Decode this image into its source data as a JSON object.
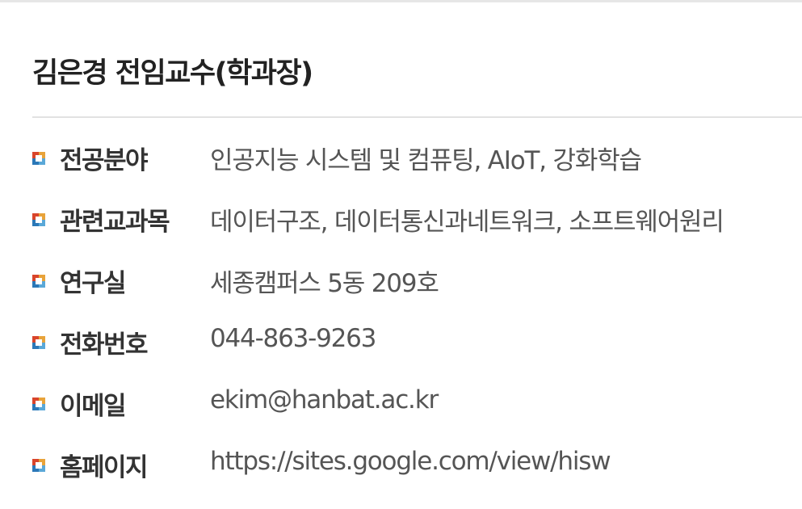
{
  "profile": {
    "name": "김은경 전임교수(학과장)"
  },
  "info_rows": [
    {
      "label": "전공분야",
      "value": "인공지능 시스템 및 컴퓨팅, AIoT, 강화학습"
    },
    {
      "label": "관련교과목",
      "value": "데이터구조, 데이터통신과네트워크, 소프트웨어원리"
    },
    {
      "label": "연구실",
      "value": "세종캠퍼스 5동 209호"
    },
    {
      "label": "전화번호",
      "value": "044-863-9263"
    },
    {
      "label": "이메일",
      "value": "ekim@hanbat.ac.kr"
    },
    {
      "label": "홈페이지",
      "value": "https://sites.google.com/view/hisw"
    }
  ],
  "colors": {
    "bullet_top_left": "#d9452b",
    "bullet_top_right": "#e8a33a",
    "bullet_bottom_left": "#2b78b8",
    "bullet_bottom_right": "#5aa8d8",
    "bullet_center": "#ffffff",
    "text_dark": "#222222",
    "text_value": "#555555"
  },
  "icons": {
    "bullet": "square-bullet-icon"
  }
}
